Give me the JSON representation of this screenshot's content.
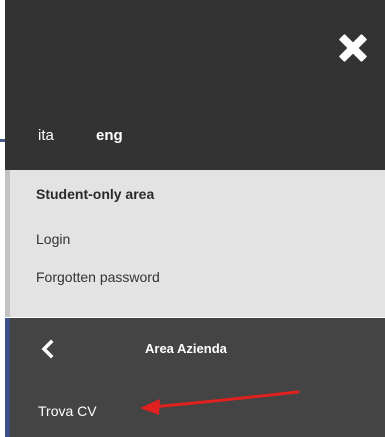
{
  "header": {
    "close_icon": "close-icon",
    "languages": [
      {
        "label": "ita",
        "active": false
      },
      {
        "label": "eng",
        "active": true
      }
    ]
  },
  "student_area": {
    "title": "Student-only area",
    "links": [
      "Login",
      "Forgotten password"
    ]
  },
  "company_area": {
    "back_icon": "chevron-left-icon",
    "title": "Area Azienda",
    "items": [
      "Trova CV"
    ]
  },
  "annotation": {
    "type": "arrow-icon",
    "color": "#e0211f"
  },
  "colors": {
    "top_bg": "#333333",
    "student_bg": "#e3e3e3",
    "area_bg": "#444444",
    "accent_bar": "#3c4f86"
  }
}
